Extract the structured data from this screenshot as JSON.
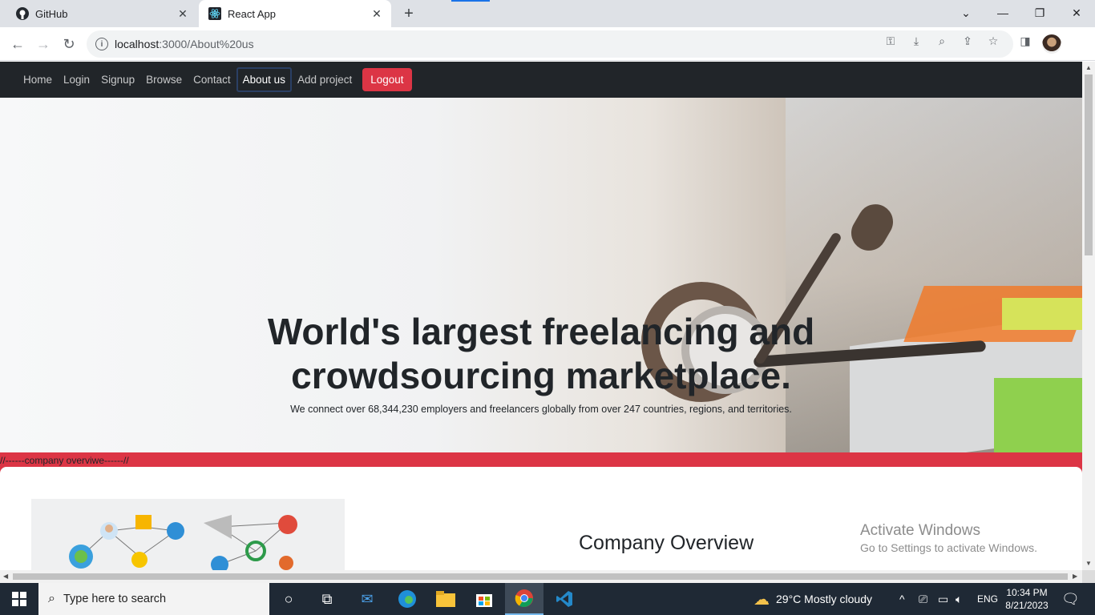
{
  "browser": {
    "tabs": [
      {
        "title": "GitHub",
        "active": false
      },
      {
        "title": "React App",
        "active": true
      }
    ],
    "url_host": "localhost",
    "url_rest": ":3000/About%20us"
  },
  "nav": {
    "links": [
      "Home",
      "Login",
      "Signup",
      "Browse",
      "Contact",
      "About us",
      "Add project"
    ],
    "active": "About us",
    "logout": "Logout"
  },
  "hero": {
    "title_line1": "World's largest freelancing and",
    "title_line2": "crowdsourcing marketplace.",
    "subtitle": "We connect over 68,344,230 employers and freelancers globally from over 247 countries, regions, and territories."
  },
  "overview": {
    "comment": "//------company overviwe------//",
    "title": "Company Overview"
  },
  "watermark": {
    "line1": "Activate Windows",
    "line2": "Go to Settings to activate Windows."
  },
  "taskbar": {
    "search_placeholder": "Type here to search",
    "weather": "29°C  Mostly cloudy",
    "lang": "ENG",
    "time": "10:34 PM",
    "date": "8/21/2023"
  },
  "colors": {
    "navbar": "#212529",
    "logout": "#dc3545",
    "band": "#dc3545"
  }
}
